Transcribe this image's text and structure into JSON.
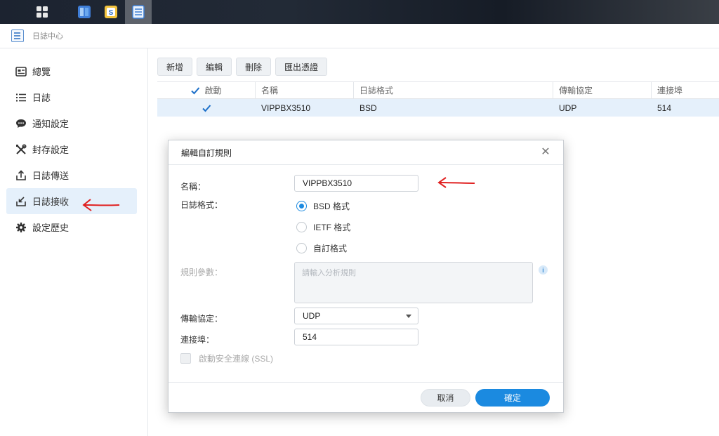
{
  "window": {
    "title": "日誌中心"
  },
  "sidebar": {
    "items": [
      {
        "label": "總覽",
        "icon": "overview-icon"
      },
      {
        "label": "日誌",
        "icon": "list-icon"
      },
      {
        "label": "通知設定",
        "icon": "chat-bubble-icon"
      },
      {
        "label": "封存設定",
        "icon": "tools-icon"
      },
      {
        "label": "日誌傳送",
        "icon": "upload-icon"
      },
      {
        "label": "日誌接收",
        "icon": "download-icon",
        "active": true
      },
      {
        "label": "設定歷史",
        "icon": "gear-icon"
      }
    ]
  },
  "toolbar": {
    "add_label": "新增",
    "edit_label": "編輯",
    "delete_label": "刪除",
    "export_label": "匯出憑證"
  },
  "table": {
    "headers": [
      "啟動",
      "名稱",
      "日誌格式",
      "傳輸協定",
      "連接埠"
    ],
    "rows": [
      {
        "enabled": true,
        "name": "VIPPBX3510",
        "format": "BSD",
        "protocol": "UDP",
        "port": "514"
      }
    ]
  },
  "dialog": {
    "title": "編輯自訂規則",
    "name_label": "名稱：",
    "name_value": "VIPPBX3510",
    "format_label": "日誌格式：",
    "format_options": [
      "BSD 格式",
      "IETF 格式",
      "自訂格式"
    ],
    "format_selected": 0,
    "rule_label": "規則參數：",
    "rule_placeholder": "請輸入分析規則",
    "protocol_label": "傳輸協定：",
    "protocol_value": "UDP",
    "port_label": "連接埠：",
    "port_value": "514",
    "ssl_label": "啟動安全連線 (SSL)",
    "cancel_label": "取消",
    "ok_label": "確定"
  },
  "colors": {
    "accent": "#1b8ae0",
    "selected_row": "#e5f0fb",
    "annotation": "#e02020"
  }
}
